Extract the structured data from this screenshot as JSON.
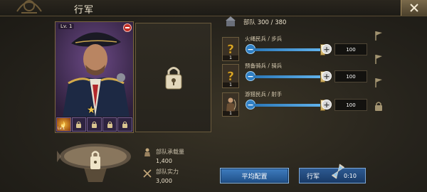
{
  "title": "行军",
  "hero": {
    "level": "Lv. 1",
    "skills": [
      {
        "level": "Lv.1",
        "locked": false
      },
      {
        "locked": true
      },
      {
        "locked": true
      },
      {
        "locked": true
      },
      {
        "locked": true
      }
    ]
  },
  "troops": {
    "label": "部队",
    "count": "300 / 380",
    "rows": [
      {
        "name": "火绳民兵 / 步兵",
        "count": "1",
        "quantity": "100",
        "slider_fraction": 0.96,
        "icon": "question-mark-icon"
      },
      {
        "name": "预备骑兵 / 骑兵",
        "count": "1",
        "quantity": "100",
        "slider_fraction": 0.96,
        "icon": "question-mark-icon"
      },
      {
        "name": "游猎民兵 / 射手",
        "count": "1",
        "quantity": "100",
        "slider_fraction": 0.96,
        "icon": "archer-icon"
      }
    ]
  },
  "airship": {
    "capacity_label": "部队承载量",
    "capacity_value": "1,400",
    "power_label": "部队实力",
    "power_value": "3,000"
  },
  "buttons": {
    "balance": "平均配置",
    "march": "行军",
    "march_time": "0:10"
  },
  "side_icons": [
    "flag-icon",
    "flag-icon",
    "flag-icon",
    "lock-icon"
  ],
  "colors": {
    "accent_blue": "#2f7fc4",
    "close_red": "#c22e25",
    "star_gold": "#f1c64b"
  }
}
